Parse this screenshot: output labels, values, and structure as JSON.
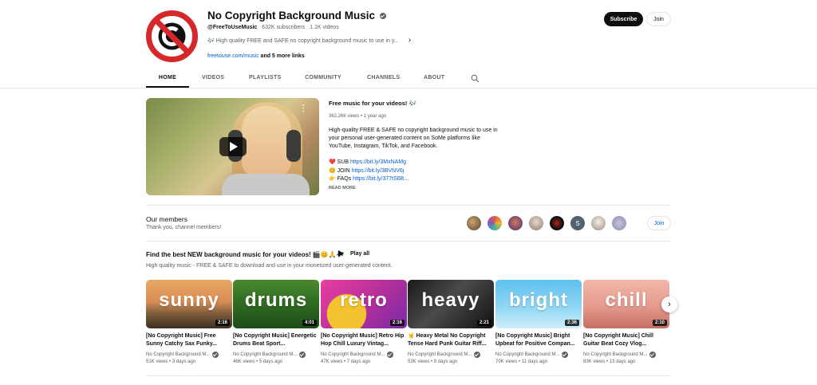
{
  "channel": {
    "name": "No Copyright Background Music",
    "handle": "@FreeToUseMusic",
    "subscribers": "632K subscribers",
    "videos": "1.1K videos",
    "description": "🎶 High quality FREE and SAFE no copyright background music to use in y...",
    "link": "freetouse.com/music",
    "more_links": "and 5 more links",
    "subscribe_label": "Subscribe",
    "join_label": "Join"
  },
  "tabs": [
    "HOME",
    "VIDEOS",
    "PLAYLISTS",
    "COMMUNITY",
    "CHANNELS",
    "ABOUT"
  ],
  "featured": {
    "title": "Free music for your videos! 🎶",
    "meta": "362,266 views • 1 year ago",
    "description": "High-quality FREE & SAFE no copyright background music to use in your personal user-generated content on SoMe platforms like YouTube, Instagram, TikTok, and Facebook.",
    "links": [
      {
        "prefix": "❤️ SUB ",
        "url": "https://bit.ly/3MxNAMg"
      },
      {
        "prefix": "😊 JOIN ",
        "url": "https://bit.ly/3BVNV6j"
      },
      {
        "prefix": "👉 FAQs ",
        "url": "https://bit.ly/377tS6B..."
      }
    ],
    "read_more": "READ MORE"
  },
  "members": {
    "title": "Our members",
    "subtitle": "Thank you, channel members!",
    "join_label": "Join",
    "avatar_letter": "S"
  },
  "playlist": {
    "title": "Find the best NEW background music for your videos! 🎬😊🙏🎶",
    "play_all": "Play all",
    "subtitle": "High quality music - FREE & SAFE to download and use in your monetized user-generated content.",
    "videos": [
      {
        "word": "sunny",
        "duration": "2:16",
        "title": "[No Copyright Music] Free Sunny Catchy Sax Funky...",
        "channel": "No Copyright Background M...",
        "meta": "51K views • 3 days ago"
      },
      {
        "word": "drums",
        "duration": "4:01",
        "title": "[No Copyright Music] Energetic Drums Beat Sport...",
        "channel": "No Copyright Background M...",
        "meta": "46K views • 5 days ago"
      },
      {
        "word": "retro",
        "duration": "2:16",
        "title": "[No Copyright Music] Retro Hip Hop Chill Luxury Vintag...",
        "channel": "No Copyright Background M...",
        "meta": "47K views • 7 days ago"
      },
      {
        "word": "heavy",
        "duration": "2:21",
        "title": "🤘 Heavy Metal No Copyright Tense Hard Punk Guitar Riff...",
        "channel": "No Copyright Background M...",
        "meta": "53K views • 9 days ago"
      },
      {
        "word": "bright",
        "duration": "2:36",
        "title": "[No Copyright Music] Bright Upbeat for Positive Compan...",
        "channel": "No Copyright Background M...",
        "meta": "70K views • 11 days ago"
      },
      {
        "word": "chill",
        "duration": "2:10",
        "title": "[No Copyright Music] Chill Guitar Beat Cozy Vlog...",
        "channel": "No Copyright Background M...",
        "meta": "83K views • 13 days ago"
      }
    ]
  },
  "colors": {
    "accent_red": "#d6282a",
    "link_blue": "#065fd4",
    "text_secondary": "#606060"
  }
}
